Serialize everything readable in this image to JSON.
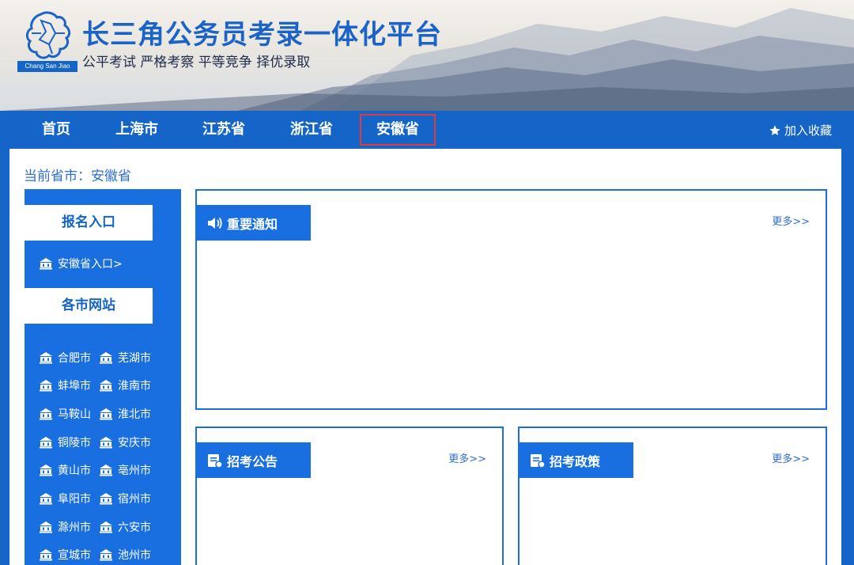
{
  "header": {
    "title": "长三角公务员考录一体化平台",
    "slogan": "公平考试 严格考察 平等竞争 择优录取",
    "logo_caption": "Chang San Jiao"
  },
  "nav": {
    "items": [
      {
        "label": "首页"
      },
      {
        "label": "上海市"
      },
      {
        "label": "江苏省"
      },
      {
        "label": "浙江省"
      },
      {
        "label": "安徽省",
        "active": true
      }
    ],
    "favorite_label": "加入收藏"
  },
  "breadcrumb": "当前省市：安徽省",
  "sidebar": {
    "register_title": "报名入口",
    "register_link": "安徽省入口>",
    "cities_title": "各市网站",
    "cities": [
      [
        "合肥市",
        "芜湖市"
      ],
      [
        "蚌埠市",
        "淮南市"
      ],
      [
        "马鞍山",
        "淮北市"
      ],
      [
        "铜陵市",
        "安庆市"
      ],
      [
        "黄山市",
        "亳州市"
      ],
      [
        "阜阳市",
        "宿州市"
      ],
      [
        "滁州市",
        "六安市"
      ],
      [
        "宣城市",
        "池州市"
      ]
    ]
  },
  "panels": {
    "notice": {
      "title": "重要通知",
      "more": "更多>>"
    },
    "announcement": {
      "title": "招考公告",
      "more": "更多>>"
    },
    "policy": {
      "title": "招考政策",
      "more": "更多>>"
    }
  },
  "colors": {
    "brand_blue": "#1565c8",
    "panel_blue": "#1a6fe0",
    "active_border": "#e53935"
  }
}
